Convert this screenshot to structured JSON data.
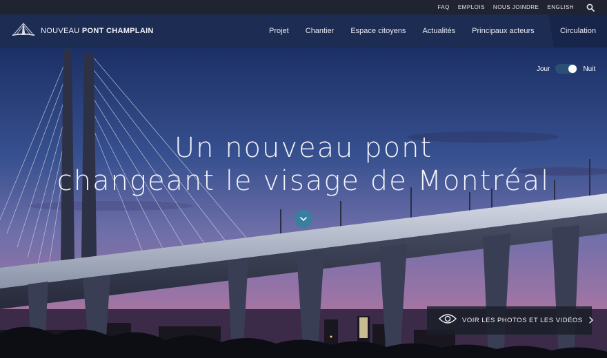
{
  "utility_nav": {
    "items": [
      "FAQ",
      "EMPLOIS",
      "NOUS JOINDRE",
      "ENGLISH"
    ],
    "search_icon": "search-icon"
  },
  "main_nav": {
    "logo": {
      "text_light": "NOUVEAU ",
      "text_bold": "PONT CHAMPLAIN",
      "icon": "bridge-logo-icon"
    },
    "items": [
      "Projet",
      "Chantier",
      "Espace citoyens",
      "Actualités",
      "Principaux acteurs"
    ],
    "circulation": "Circulation"
  },
  "hero": {
    "toggle": {
      "left_label": "Jour",
      "right_label": "Nuit",
      "state": "Nuit"
    },
    "title_line1": "Un nouveau pont",
    "title_line2": "changeant le visage de Montréal",
    "scroll_icon": "chevron-down-icon",
    "media_button": {
      "label": "VOIR LES PHOTOS ET LES VIDÉOS",
      "icon": "eye-icon",
      "arrow_icon": "chevron-right-icon"
    }
  },
  "colors": {
    "utility_bg": "#1f2430",
    "nav_bg": "#1d2c53",
    "accent_button": "#3a7fa0",
    "sky_top": "#1c3066",
    "sky_bottom": "#8d6aa6"
  }
}
